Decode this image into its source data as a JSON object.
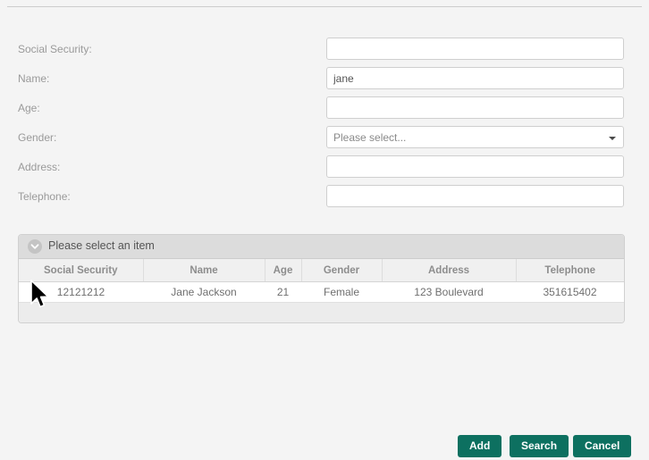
{
  "form": {
    "fields": [
      {
        "label": "Social Security:",
        "value": "",
        "placeholder": "",
        "type": "text",
        "name": "social-security"
      },
      {
        "label": "Name:",
        "value": "jane",
        "placeholder": "",
        "type": "text",
        "name": "name"
      },
      {
        "label": "Age:",
        "value": "",
        "placeholder": "",
        "type": "text",
        "name": "age"
      },
      {
        "label": "Gender:",
        "value": "Please select...",
        "placeholder": "",
        "type": "select",
        "name": "gender"
      },
      {
        "label": "Address:",
        "value": "",
        "placeholder": "",
        "type": "text",
        "name": "address"
      },
      {
        "label": "Telephone:",
        "value": "",
        "placeholder": "",
        "type": "text",
        "name": "telephone"
      }
    ]
  },
  "panel": {
    "title": "Please select an item",
    "collapse_icon": "chevron-down-icon"
  },
  "table": {
    "columns": [
      "Social Security",
      "Name",
      "Age",
      "Gender",
      "Address",
      "Telephone"
    ],
    "rows": [
      [
        "12121212",
        "Jane Jackson",
        "21",
        "Female",
        "123 Boulevard",
        "351615402"
      ]
    ]
  },
  "buttons": {
    "add": "Add",
    "search": "Search",
    "cancel": "Cancel"
  },
  "colors": {
    "accent": "#0d7060",
    "page_background": "#f4f4f4",
    "panel_header": "#dcdcdc",
    "label_text": "#9a9a9a"
  },
  "cursor": {
    "icon": "mouse-pointer-icon"
  }
}
